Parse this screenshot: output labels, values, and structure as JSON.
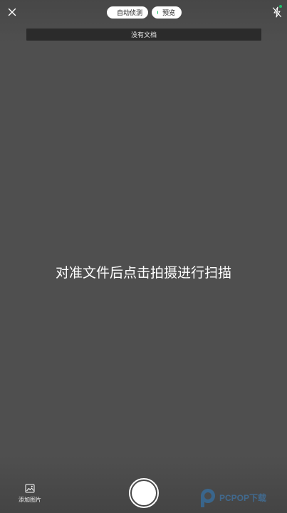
{
  "top_bar": {
    "close_icon": "close-icon",
    "auto_detect_label": "自动侦测",
    "preview_label": "预览",
    "flash_icon": "flash-off-icon",
    "status_color": "#1ec06a"
  },
  "banner": {
    "text": "没有文档"
  },
  "hint": {
    "text": "对准文件后点击拍摄进行扫描"
  },
  "bottom_bar": {
    "add_image_icon": "image-icon",
    "add_image_label": "添加图片",
    "shutter": "shutter-button"
  },
  "watermark": {
    "text": "PCPOP下载"
  }
}
